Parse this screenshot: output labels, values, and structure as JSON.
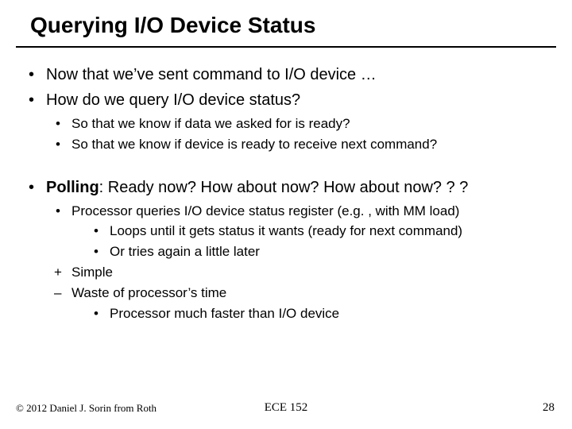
{
  "title": "Querying I/O Device Status",
  "bullets": {
    "b1": "Now that we’ve sent command to I/O device …",
    "b2": "How do we query I/O device status?",
    "b2a": "So that we know if data we asked for is ready?",
    "b2b": "So that we know if device is ready to receive next command?",
    "b3_strong": "Polling",
    "b3_rest": ": Ready now? How about now? How about now? ? ?",
    "b3a": "Processor queries I/O device status register (e.g. , with MM load)",
    "b3a1": "Loops until it gets status it wants (ready for next command)",
    "b3a2": "Or tries again a little later",
    "b3b": "Simple",
    "b3c": "Waste of processor’s time",
    "b3c1": "Processor much faster than I/O device"
  },
  "footer": {
    "left": "© 2012 Daniel J. Sorin from Roth",
    "center": "ECE 152",
    "right": "28"
  }
}
